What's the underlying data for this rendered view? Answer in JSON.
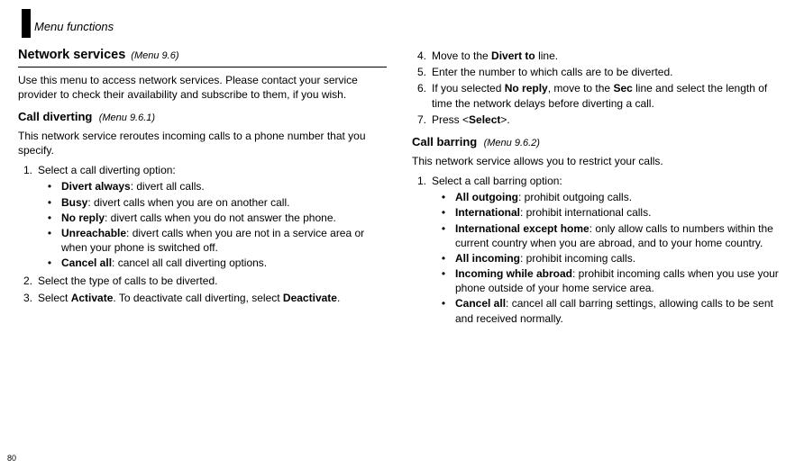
{
  "page_number": "80",
  "header": "Menu functions",
  "left": {
    "section_title": "Network services",
    "section_menu": "(Menu 9.6)",
    "intro": "Use this menu to access network services. Please contact your service provider to check their availability and subscribe to them, if you wish.",
    "sub1_title": "Call diverting",
    "sub1_menu": "(Menu 9.6.1)",
    "sub1_intro": "This network service reroutes incoming calls to a phone number that you specify.",
    "step1_num": "1.",
    "step1_text": "Select a call diverting option:",
    "opts": [
      {
        "label": "Divert always",
        "desc": ": divert all calls."
      },
      {
        "label": "Busy",
        "desc": ": divert calls when you are on another call."
      },
      {
        "label": "No reply",
        "desc": ": divert calls when you do not answer the phone."
      },
      {
        "label": "Unreachable",
        "desc": ": divert calls when you are not in a service area or when your phone is switched off."
      },
      {
        "label": "Cancel all",
        "desc": ": cancel all call diverting options."
      }
    ],
    "step2_num": "2.",
    "step2_text": "Select the type of calls to be diverted.",
    "step3_num": "3.",
    "step3_pre": "Select ",
    "step3_b1": "Activate",
    "step3_mid": ". To deactivate call diverting, select ",
    "step3_b2": "Deactivate",
    "step3_post": "."
  },
  "right": {
    "step4_num": "4.",
    "step4_pre": "Move to the ",
    "step4_b": "Divert to",
    "step4_post": " line.",
    "step5_num": "5.",
    "step5_text": "Enter the number to which calls are to be diverted.",
    "step6_num": "6.",
    "step6_pre": "If you selected ",
    "step6_b1": "No reply",
    "step6_mid": ", move to the ",
    "step6_b2": "Sec",
    "step6_post": " line and select the length of time the network delays before diverting a call.",
    "step7_num": "7.",
    "step7_pre": "Press <",
    "step7_b": "Select",
    "step7_post": ">.",
    "sub2_title": "Call barring",
    "sub2_menu": "(Menu 9.6.2)",
    "sub2_intro": "This network service allows you to restrict your calls.",
    "bstep1_num": "1.",
    "bstep1_text": "Select a call barring option:",
    "bopts": [
      {
        "label": "All outgoing",
        "desc": ": prohibit outgoing calls."
      },
      {
        "label": "International",
        "desc": ": prohibit international calls."
      },
      {
        "label": "International except home",
        "desc": ": only allow calls to numbers within the current country when you are abroad, and to your home country."
      },
      {
        "label": "All incoming",
        "desc": ": prohibit incoming calls."
      },
      {
        "label": "Incoming while abroad",
        "desc": ": prohibit incoming calls when you use your phone outside of your home service area."
      },
      {
        "label": "Cancel all",
        "desc": ": cancel all call barring settings, allowing calls to be sent and received normally."
      }
    ]
  }
}
